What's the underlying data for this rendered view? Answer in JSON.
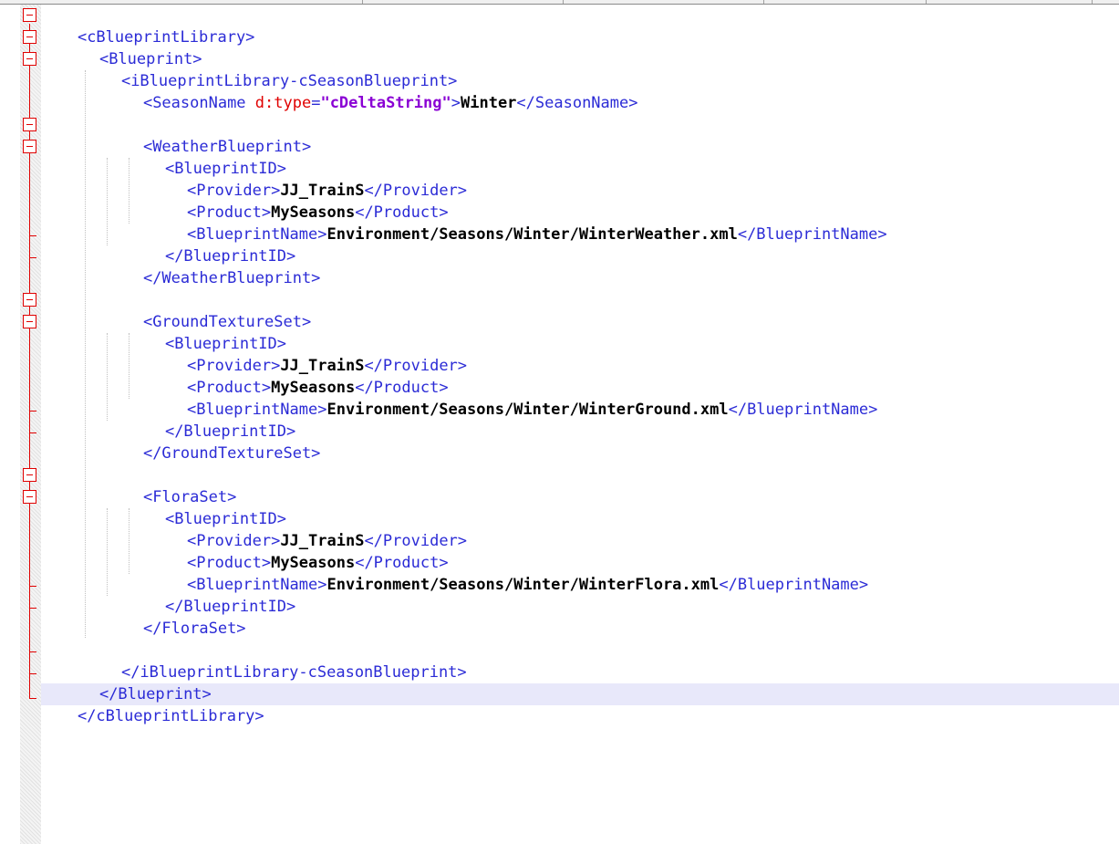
{
  "editor": {
    "colors": {
      "tag": "#2b2bd6",
      "attr": "#e00000",
      "string": "#8a00d4",
      "text": "#000000",
      "fold": "#e00000",
      "current_line": "#e8e8fa"
    },
    "lines": [
      {
        "open": "<cBlueprintLibrary>"
      },
      {
        "open": "<Blueprint>"
      },
      {
        "open": "<iBlueprintLibrary-cSeasonBlueprint>"
      },
      {
        "open": "<SeasonName ",
        "attr": "d:type",
        "eq": "=",
        "str": "\"cDeltaString\"",
        "gt": ">",
        "text": "Winter",
        "close": "</SeasonName>"
      },
      {},
      {
        "open": "<WeatherBlueprint>"
      },
      {
        "open": "<BlueprintID>"
      },
      {
        "open": "<Provider>",
        "text": "JJ_TrainS",
        "close": "</Provider>"
      },
      {
        "open": "<Product>",
        "text": "MySeasons",
        "close": "</Product>"
      },
      {
        "open": "<BlueprintName>",
        "text": "Environment/Seasons/Winter/WinterWeather.xml",
        "close": "</BlueprintName>"
      },
      {
        "open": "</BlueprintID>"
      },
      {
        "open": "</WeatherBlueprint>"
      },
      {},
      {
        "open": "<GroundTextureSet>"
      },
      {
        "open": "<BlueprintID>"
      },
      {
        "open": "<Provider>",
        "text": "JJ_TrainS",
        "close": "</Provider>"
      },
      {
        "open": "<Product>",
        "text": "MySeasons",
        "close": "</Product>"
      },
      {
        "open": "<BlueprintName>",
        "text": "Environment/Seasons/Winter/WinterGround.xml",
        "close": "</BlueprintName>"
      },
      {
        "open": "</BlueprintID>"
      },
      {
        "open": "</GroundTextureSet>"
      },
      {},
      {
        "open": "<FloraSet>"
      },
      {
        "open": "<BlueprintID>"
      },
      {
        "open": "<Provider>",
        "text": "JJ_TrainS",
        "close": "</Provider>"
      },
      {
        "open": "<Product>",
        "text": "MySeasons",
        "close": "</Product>"
      },
      {
        "open": "<BlueprintName>",
        "text": "Environment/Seasons/Winter/WinterFlora.xml",
        "close": "</BlueprintName>"
      },
      {
        "open": "</BlueprintID>"
      },
      {
        "open": "</FloraSet>"
      },
      {},
      {},
      {
        "open": "</iBlueprintLibrary-cSeasonBlueprint>"
      },
      {
        "open": "</Blueprint>"
      },
      {
        "open": "</cBlueprintLibrary>"
      }
    ]
  }
}
